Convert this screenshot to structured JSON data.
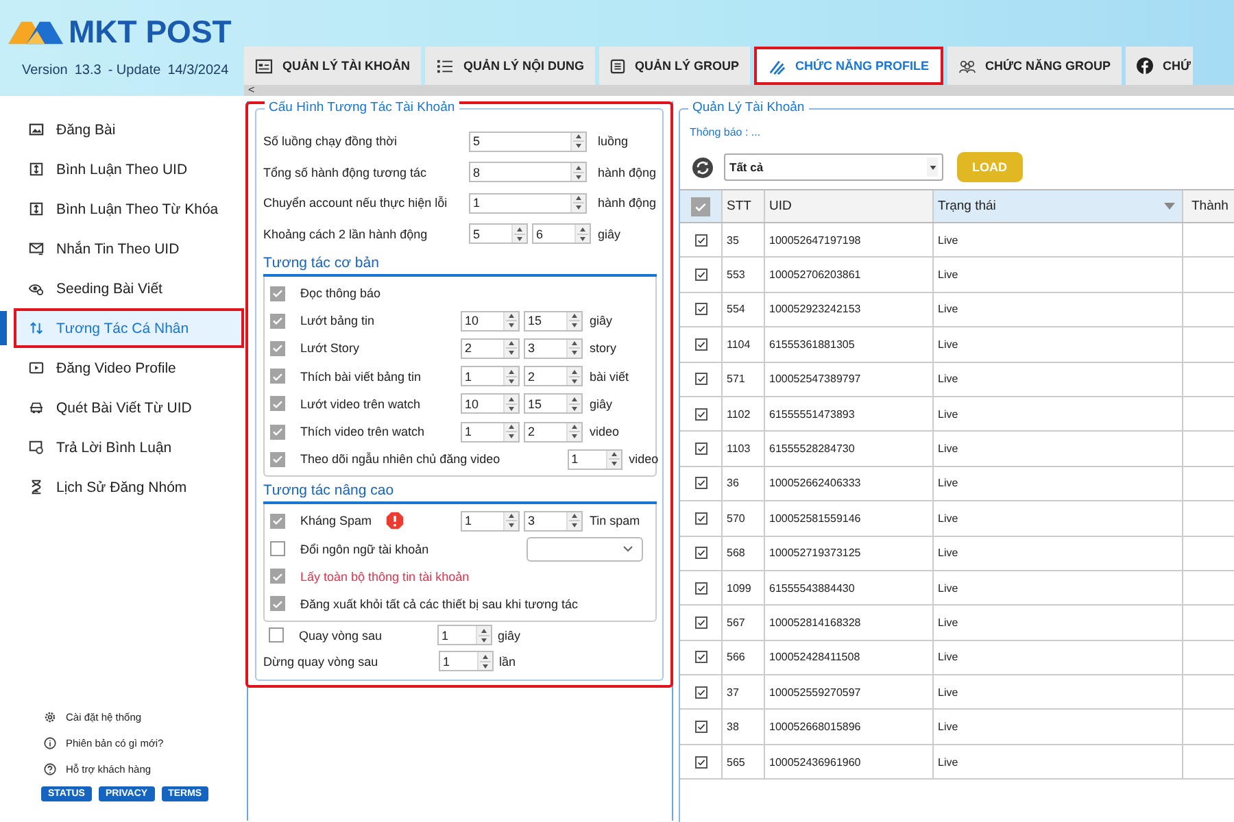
{
  "header": {
    "logo_text": "MKT POST",
    "version_label": "Version",
    "version": "13.3",
    "update_label": "- Update",
    "update_date": "14/3/2024"
  },
  "tabs": [
    {
      "label": "QUẢN LÝ TÀI KHOẢN",
      "selected": false
    },
    {
      "label": "QUẢN LÝ NỘI DUNG",
      "selected": false
    },
    {
      "label": "QUẢN LÝ GROUP",
      "selected": false
    },
    {
      "label": "CHỨC NĂNG PROFILE",
      "selected": true
    },
    {
      "label": "CHỨC NĂNG GROUP",
      "selected": false
    },
    {
      "label": "CHỨ",
      "selected": false
    }
  ],
  "scroll_arrow": "<",
  "sidebar": {
    "items": [
      {
        "label": "Đăng Bài",
        "selected": false
      },
      {
        "label": "Bình Luận Theo UID",
        "selected": false
      },
      {
        "label": "Bình Luận Theo Từ Khóa",
        "selected": false
      },
      {
        "label": "Nhắn Tin Theo UID",
        "selected": false
      },
      {
        "label": "Seeding Bài Viết",
        "selected": false
      },
      {
        "label": "Tương Tác Cá Nhân",
        "selected": true
      },
      {
        "label": "Đăng Video Profile",
        "selected": false
      },
      {
        "label": "Quét Bài Viết Từ UID",
        "selected": false
      },
      {
        "label": "Trả Lời Bình Luận",
        "selected": false
      },
      {
        "label": "Lịch Sử Đăng Nhóm",
        "selected": false
      }
    ],
    "footer_links": [
      "Cài đặt hệ thống",
      "Phiên bản có gì mới?",
      "Hỗ trợ khách hàng"
    ],
    "footer_buttons": [
      "STATUS",
      "PRIVACY",
      "TERMS"
    ]
  },
  "config": {
    "title": "Cấu Hình Tương Tác Tài Khoản",
    "settings": [
      {
        "label": "Số luồng chạy đồng thời",
        "values": [
          "5"
        ],
        "unit": "luồng"
      },
      {
        "label": "Tổng số hành động tương tác",
        "values": [
          "8"
        ],
        "unit": "hành động"
      },
      {
        "label": "Chuyển account nếu thực hiện lỗi",
        "values": [
          "1"
        ],
        "unit": "hành động"
      },
      {
        "label": "Khoảng cách 2 lần hành động",
        "values": [
          "5",
          "6"
        ],
        "unit": "giây"
      }
    ],
    "basic": {
      "title": "Tương tác cơ bản",
      "items": [
        {
          "kind": "plain",
          "label": "Đọc thông báo",
          "checked": true
        },
        {
          "kind": "spin",
          "label": "Lướt bảng tin",
          "checked": true,
          "values": [
            "10",
            "15"
          ],
          "unit": "giây"
        },
        {
          "kind": "spin",
          "label": "Lướt Story",
          "checked": true,
          "values": [
            "2",
            "3"
          ],
          "unit": "story"
        },
        {
          "kind": "spin",
          "label": "Thích bài viết bảng tin",
          "checked": true,
          "values": [
            "1",
            "2"
          ],
          "unit": "bài viết"
        },
        {
          "kind": "spin",
          "label": "Lướt video trên watch",
          "checked": true,
          "values": [
            "10",
            "15"
          ],
          "unit": "giây"
        },
        {
          "kind": "spin",
          "label": "Thích video trên watch",
          "checked": true,
          "values": [
            "1",
            "2"
          ],
          "unit": "video"
        },
        {
          "kind": "spin",
          "label": "Theo dõi ngẫu nhiên chủ đăng video",
          "checked": true,
          "values": [
            "1"
          ],
          "unit": "video"
        }
      ]
    },
    "advanced": {
      "title": "Tương tác nâng cao",
      "items": [
        {
          "kind": "spin-warning",
          "label": "Kháng Spam",
          "checked": true,
          "values": [
            "1",
            "3"
          ],
          "unit": "Tin spam"
        },
        {
          "kind": "dropdown",
          "label": "Đổi ngôn ngữ tài khoản",
          "checked": false
        },
        {
          "kind": "highlight",
          "label": "Lấy toàn bộ thông tin tài khoản",
          "checked": true
        },
        {
          "kind": "plain",
          "label": "Đăng xuất khỏi tất cả các thiết bị sau khi tương tác",
          "checked": true
        }
      ]
    },
    "loop": [
      {
        "kind": "check",
        "label": "Quay vòng sau",
        "checked": false,
        "value": "1",
        "unit": "giây"
      },
      {
        "kind": "text",
        "label": "Dừng quay vòng sau",
        "value": "1",
        "unit": "lần"
      }
    ]
  },
  "accounts": {
    "title": "Quản Lý Tài Khoản",
    "notice": "Thông báo : ...",
    "filter": "Tất cả",
    "load_button": "LOAD",
    "select_all_checked": true,
    "columns": [
      "STT",
      "UID",
      "Trạng thái",
      "Thành"
    ],
    "rows": [
      {
        "checked": true,
        "stt": "35",
        "uid": "100052647197198",
        "status": "Live"
      },
      {
        "checked": true,
        "stt": "553",
        "uid": "100052706203861",
        "status": "Live"
      },
      {
        "checked": true,
        "stt": "554",
        "uid": "100052923242153",
        "status": "Live"
      },
      {
        "checked": true,
        "stt": "1104",
        "uid": "61555361881305",
        "status": "Live"
      },
      {
        "checked": true,
        "stt": "571",
        "uid": "100052547389797",
        "status": "Live"
      },
      {
        "checked": true,
        "stt": "1102",
        "uid": "61555551473893",
        "status": "Live"
      },
      {
        "checked": true,
        "stt": "1103",
        "uid": "61555528284730",
        "status": "Live"
      },
      {
        "checked": true,
        "stt": "36",
        "uid": "100052662406333",
        "status": "Live"
      },
      {
        "checked": true,
        "stt": "570",
        "uid": "100052581559146",
        "status": "Live"
      },
      {
        "checked": true,
        "stt": "568",
        "uid": "100052719373125",
        "status": "Live"
      },
      {
        "checked": true,
        "stt": "1099",
        "uid": "61555543884430",
        "status": "Live"
      },
      {
        "checked": true,
        "stt": "567",
        "uid": "100052814168328",
        "status": "Live"
      },
      {
        "checked": true,
        "stt": "566",
        "uid": "100052428411508",
        "status": "Live"
      },
      {
        "checked": true,
        "stt": "37",
        "uid": "100052559270597",
        "status": "Live"
      },
      {
        "checked": true,
        "stt": "38",
        "uid": "100052668015896",
        "status": "Live"
      },
      {
        "checked": true,
        "stt": "565",
        "uid": "100052436961960",
        "status": "Live"
      }
    ]
  }
}
